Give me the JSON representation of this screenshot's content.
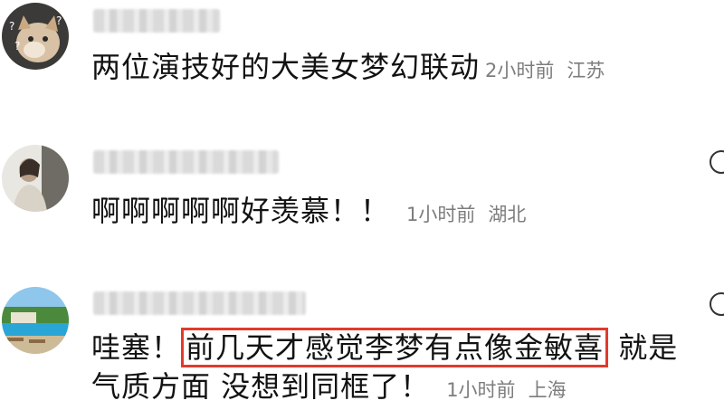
{
  "comments": [
    {
      "text": "两位演技好的大美女梦幻联动",
      "time": "2小时前",
      "location": "江苏"
    },
    {
      "text": "啊啊啊啊啊好羡慕！！",
      "time": "1小时前",
      "location": "湖北"
    },
    {
      "text_before": "哇塞！",
      "highlight": "前几天才感觉李梦有点像金敏喜",
      "text_after": " 就是",
      "line2": "气质方面 没想到同框了！",
      "time": "1小时前",
      "location": "上海"
    }
  ],
  "colors": {
    "highlight_border": "#e23a2c",
    "meta_text": "#7d7d7d"
  }
}
